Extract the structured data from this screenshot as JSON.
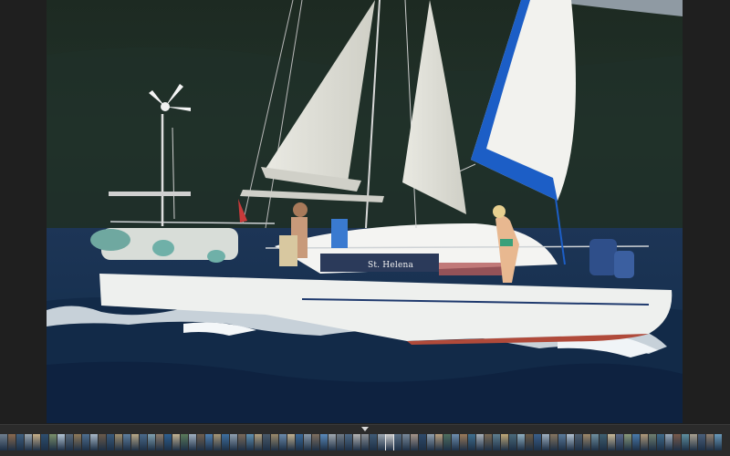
{
  "viewer": {
    "photo": {
      "subject": "catamaran-sailing",
      "boat_name": "St. Helena"
    }
  },
  "filmstrip": {
    "active_index": 47,
    "thumbnail_colors": [
      "#6f7f8f",
      "#8a6a4f",
      "#3f5f7f",
      "#9aa7b1",
      "#c8b08a",
      "#2f4f6f",
      "#7a8f6a",
      "#b3c4d4",
      "#5a6a7a",
      "#8f7a5a",
      "#4f6f8f",
      "#a8b8c8",
      "#6a5a4a",
      "#3a5a7a",
      "#9f8f6f",
      "#5f7f9f",
      "#b8a888",
      "#4a6a8a",
      "#7f9faf",
      "#8a7a6a",
      "#2f5f8f",
      "#c4b494",
      "#5a7a5a",
      "#9fafbf",
      "#6f5f4f",
      "#4f7faf",
      "#a89878",
      "#3f6f9f",
      "#8fa0b0",
      "#7a6a5a",
      "#5f8faf",
      "#b0a080",
      "#4a5a6a",
      "#9a8a6a",
      "#6a8aaa",
      "#c0b090",
      "#3a6a9a",
      "#8a9aaa",
      "#7f6f5f",
      "#5a8aba",
      "#a0a8b0",
      "#6f7a85",
      "#4f6a85",
      "#b5b5b5",
      "#8a8f95",
      "#3f5a75",
      "#9aa5b0",
      "#d0d0d0",
      "#5a6f85",
      "#7a8a9a",
      "#a5958a",
      "#2f4a6a",
      "#8f9fae",
      "#b8a080",
      "#4f6f5f",
      "#6f8faf",
      "#9a7a5a",
      "#3f6f8f",
      "#a8b0b8",
      "#7a6a55",
      "#5f7f8f",
      "#c0a878",
      "#4a6a7a",
      "#8fafc0",
      "#6a5a45",
      "#3a5f8a",
      "#9fb0c0",
      "#857560",
      "#5a7a9a",
      "#b0c0d0",
      "#4f5f6f",
      "#a08a6a",
      "#6f8f9f",
      "#3f5f6f",
      "#c8b898",
      "#5a6a8a",
      "#8a9a7a",
      "#4a7aaa",
      "#b09a7a",
      "#6f7f6f",
      "#3f6a8a",
      "#9aaaba",
      "#7a5a4a",
      "#5f8f9f",
      "#a8a090",
      "#4a5f7a",
      "#8f7f6f",
      "#6a9aba"
    ]
  }
}
